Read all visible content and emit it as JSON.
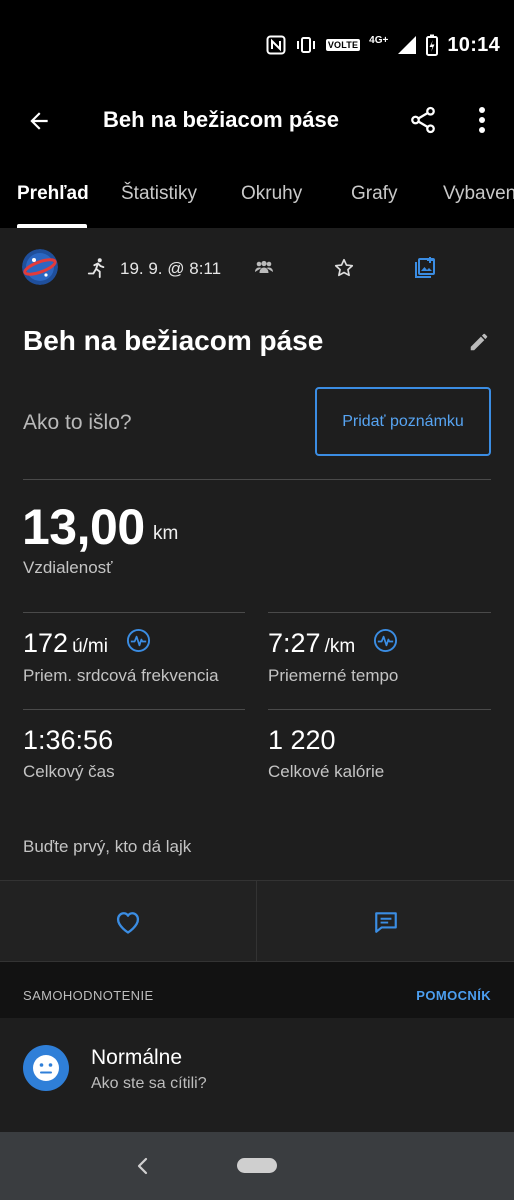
{
  "status_bar": {
    "time": "10:14",
    "volte": "VOLTE",
    "network": "4G+",
    "icons": [
      "nfc-icon",
      "vibrate-icon",
      "volte-icon",
      "lte-icon",
      "signal-icon",
      "battery-charging-icon"
    ]
  },
  "app_bar": {
    "title": "Beh na bežiacom páse",
    "icons": [
      "back-arrow-icon",
      "share-icon",
      "more-vert-icon"
    ]
  },
  "tabs": [
    {
      "label": "Prehľad",
      "active": true
    },
    {
      "label": "Štatistiky"
    },
    {
      "label": "Okruhy"
    },
    {
      "label": "Grafy"
    },
    {
      "label": "Vybavenie"
    }
  ],
  "activity": {
    "date": "19. 9. @ 8:11",
    "title": "Beh na bežiacom páse",
    "icons": [
      "avatar",
      "running-icon",
      "people-icon",
      "star-outline-icon",
      "add-photo-icon",
      "edit-pencil-icon"
    ],
    "how_prompt": "Ako to išlo?",
    "add_note_label": "Pridať poznámku",
    "distance": {
      "value": "13,00",
      "unit": "km",
      "label": "Vzdialenosť"
    },
    "stats": {
      "heart_rate": {
        "value": "172",
        "unit": "ú/mi",
        "label": "Priem. srdcová frekvencia"
      },
      "pace": {
        "value": "7:27",
        "unit": "/km",
        "label": "Priemerné tempo"
      },
      "time": {
        "value": "1:36:56",
        "label": "Celkový čas"
      },
      "calories": {
        "value": "1 220",
        "label": "Celkové kalórie"
      }
    },
    "like_prompt": "Buďte prvý, kto dá lajk"
  },
  "self_eval": {
    "section_title": "SAMOHODNOTENIE",
    "section_link": "POMOCNÍK",
    "feeling": "Normálne",
    "feeling_sub": "Ako ste sa cítili?"
  },
  "colors": {
    "accent": "#3b8de3",
    "background": "#1e1e1e",
    "app_bar": "#000000",
    "nav_bar": "#3a3d40"
  }
}
